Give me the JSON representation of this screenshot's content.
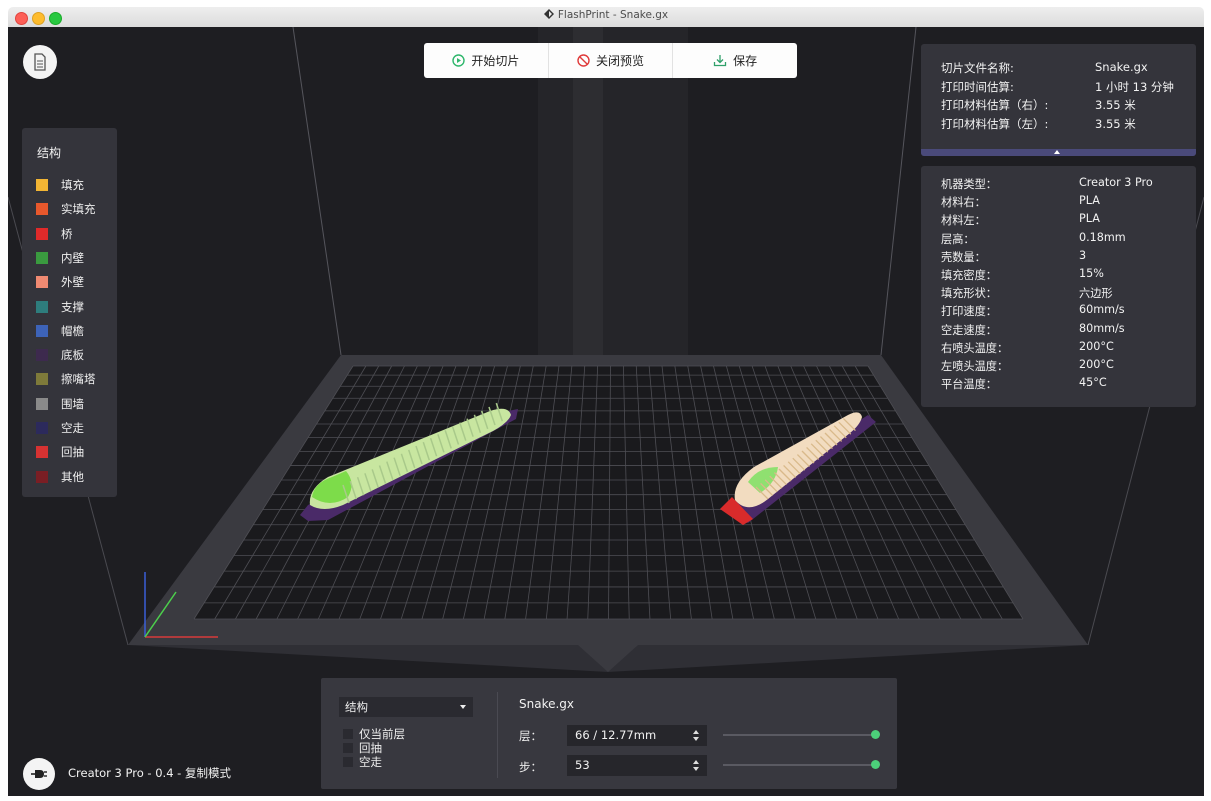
{
  "window": {
    "title": "FlashPrint - Snake.gx"
  },
  "toolbar": {
    "start_slice": "开始切片",
    "close_preview": "关闭预览",
    "save": "保存"
  },
  "legend": {
    "title": "结构",
    "items": [
      {
        "label": "填充",
        "color": "#f2b534"
      },
      {
        "label": "实填充",
        "color": "#e8582c"
      },
      {
        "label": "桥",
        "color": "#e02a2a"
      },
      {
        "label": "内壁",
        "color": "#3a9a3f"
      },
      {
        "label": "外壁",
        "color": "#f08a72"
      },
      {
        "label": "支撑",
        "color": "#2e7d7d"
      },
      {
        "label": "帽檐",
        "color": "#3d63b8"
      },
      {
        "label": "底板",
        "color": "#3d2a4e"
      },
      {
        "label": "擦嘴塔",
        "color": "#7e7a3a"
      },
      {
        "label": "围墙",
        "color": "#8a8a8a"
      },
      {
        "label": "空走",
        "color": "#2c2a5c"
      },
      {
        "label": "回抽",
        "color": "#d63232"
      },
      {
        "label": "其他",
        "color": "#7a1e24"
      }
    ]
  },
  "slice_info": {
    "rows": [
      {
        "label": "切片文件名称:",
        "value": "Snake.gx"
      },
      {
        "label": "打印时间估算:",
        "value": "1 小时 13 分钟"
      },
      {
        "label": "打印材料估算（右）:",
        "value": "3.55 米"
      },
      {
        "label": "打印材料估算（左）:",
        "value": "3.55 米"
      }
    ]
  },
  "specs": {
    "rows": [
      {
        "label": "机器类型：",
        "value": "Creator 3 Pro"
      },
      {
        "label": "材料右：",
        "value": "PLA"
      },
      {
        "label": "材料左：",
        "value": "PLA"
      },
      {
        "label": "层高：",
        "value": "0.18mm"
      },
      {
        "label": "壳数量：",
        "value": "3"
      },
      {
        "label": "填充密度：",
        "value": "15%"
      },
      {
        "label": "填充形状：",
        "value": "六边形"
      },
      {
        "label": "打印速度：",
        "value": "60mm/s"
      },
      {
        "label": "空走速度：",
        "value": "80mm/s"
      },
      {
        "label": "右喷头温度：",
        "value": "200°C"
      },
      {
        "label": "左喷头温度：",
        "value": "200°C"
      },
      {
        "label": "平台温度：",
        "value": "45°C"
      }
    ]
  },
  "bottom_panel": {
    "view_select": "结构",
    "options": [
      "仅当前层",
      "回抽",
      "空走"
    ],
    "file_name": "Snake.gx",
    "layer_label": "层：",
    "layer_value": "66 / 12.77mm",
    "step_label": "步：",
    "step_value": "53",
    "layer_slider_value": 1.0,
    "step_slider_value": 1.0
  },
  "status": {
    "text": "Creator 3 Pro - 0.4 - 复制模式"
  },
  "icons": {
    "file_button": "document-icon",
    "machine_button": "plug-icon"
  }
}
